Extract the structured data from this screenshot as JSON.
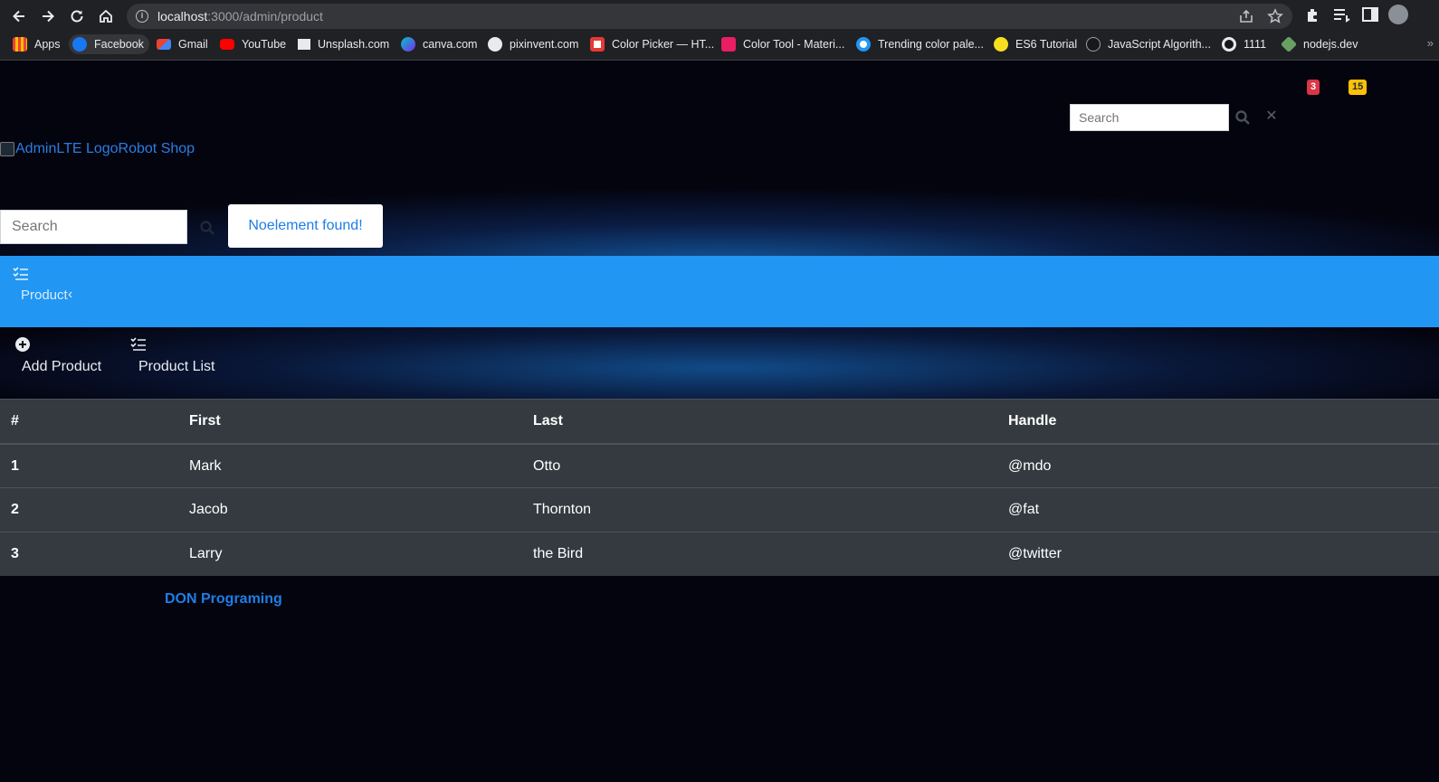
{
  "browser": {
    "url_host": "localhost",
    "url_rest": ":3000/admin/product",
    "bookmarks": [
      {
        "label": "Apps",
        "icon": "apps-grid-icon",
        "color": "#e37400"
      },
      {
        "label": "Facebook",
        "icon": "facebook-icon",
        "color": "#1877f2"
      },
      {
        "label": "Gmail",
        "icon": "gmail-icon",
        "color": "#ea4335"
      },
      {
        "label": "YouTube",
        "icon": "youtube-icon",
        "color": "#ff0000"
      },
      {
        "label": "Unsplash.com",
        "icon": "unsplash-icon",
        "color": "#e8eaed"
      },
      {
        "label": "canva.com",
        "icon": "canva-icon",
        "color": "#00c4cc"
      },
      {
        "label": "pixinvent.com",
        "icon": "pixinvent-icon",
        "color": "#e8eaed"
      },
      {
        "label": "Color Picker — HT...",
        "icon": "color-picker-icon",
        "color": "#e53935"
      },
      {
        "label": "Color Tool - Materi...",
        "icon": "color-tool-icon",
        "color": "#e91e63"
      },
      {
        "label": "Trending color pale...",
        "icon": "coolors-icon",
        "color": "#2196f3"
      },
      {
        "label": "ES6 Tutorial",
        "icon": "js-icon",
        "color": "#f7df1e"
      },
      {
        "label": "JavaScript Algorith...",
        "icon": "algorithm-icon",
        "color": "#3c4043"
      },
      {
        "label": "1111",
        "icon": "warp-icon",
        "color": "#e8eaed"
      },
      {
        "label": "nodejs.dev",
        "icon": "nodejs-icon",
        "color": "#68a063"
      }
    ]
  },
  "navbar": {
    "badges": {
      "notifications": "3",
      "messages": "15"
    },
    "search_placeholder": "Search",
    "colors": {
      "red_badge": "#dc3545",
      "yellow_badge": "#ffc107"
    }
  },
  "brand": {
    "logo_alt": "AdminLTE Logo",
    "name": "Robot Shop"
  },
  "sidebar": {
    "search_placeholder": "Search",
    "search_result": "Noelement found!",
    "active_menu": {
      "label": "Product",
      "icon": "tasks-icon"
    },
    "sub_items": [
      {
        "label": "Add Product",
        "icon": "plus-circle-icon"
      },
      {
        "label": "Product List",
        "icon": "tasks-icon"
      }
    ],
    "colors": {
      "active_bg": "#2196f3"
    }
  },
  "table": {
    "headers": [
      "#",
      "First",
      "Last",
      "Handle"
    ],
    "rows": [
      [
        "1",
        "Mark",
        "Otto",
        "@mdo"
      ],
      [
        "2",
        "Jacob",
        "Thornton",
        "@fat"
      ],
      [
        "3",
        "Larry",
        "the Bird",
        "@twitter"
      ]
    ]
  },
  "footer": {
    "link": "DON Programing"
  }
}
